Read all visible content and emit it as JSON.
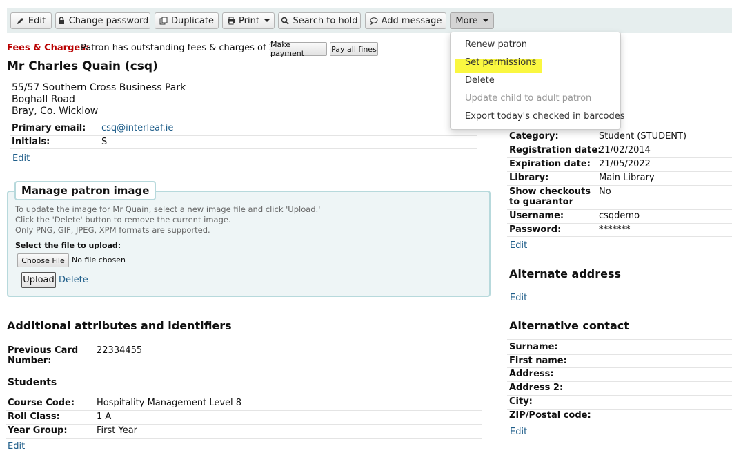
{
  "toolbar": {
    "edit": "Edit",
    "change_password": "Change password",
    "duplicate": "Duplicate",
    "print": "Print",
    "search_to_hold": "Search to hold",
    "add_message": "Add message",
    "more": "More"
  },
  "more_menu": {
    "renew": "Renew patron",
    "set_permissions": "Set permissions",
    "delete": "Delete",
    "update_child": "Update child to adult patron",
    "export_barcodes": "Export today's checked in barcodes"
  },
  "fees": {
    "label": "Fees & Charges:",
    "text": "Patron has outstanding fees & charges of 2.00.",
    "make_payment": "Make payment",
    "pay_all": "Pay all fines"
  },
  "patron": {
    "name": "Mr Charles Quain (csq)",
    "address1": "55/57 Southern Cross Business Park",
    "address2": "Boghall Road",
    "address3": "Bray, Co. Wicklow",
    "email_label": "Primary email:",
    "email": "csq@interleaf.ie",
    "initials_label": "Initials:",
    "initials": "S",
    "edit": "Edit"
  },
  "image_box": {
    "legend": "Manage patron image",
    "help1": "To update the image for Mr Quain, select a new image file and click 'Upload.'",
    "help2": "Click the 'Delete' button to remove the current image.",
    "help3": "Only PNG, GIF, JPEG, XPM formats are supported.",
    "select_label": "Select the file to upload:",
    "choose": "Choose File",
    "no_file": "No file chosen",
    "upload": "Upload",
    "delete": "Delete"
  },
  "attributes": {
    "heading": "Additional attributes and identifiers",
    "card_label_1": "Previous Card",
    "card_label_2": "Number:",
    "card_value": "22334455",
    "students_heading": "Students",
    "course_label": "Course Code:",
    "course_value": "Hospitality Management Level 8",
    "roll_label": "Roll Class:",
    "roll_value": "1 A",
    "year_label": "Year Group:",
    "year_value": "First Year",
    "edit": "Edit"
  },
  "library": {
    "category_label": "Category:",
    "category": "Student (STUDENT)",
    "reg_label": "Registration date:",
    "reg": "21/02/2014",
    "exp_label": "Expiration date:",
    "exp": "21/05/2022",
    "lib_label": "Library:",
    "lib": "Main Library",
    "show_label_1": "Show checkouts",
    "show_label_2": "to guarantor",
    "show": "No",
    "user_label": "Username:",
    "user": "csqdemo",
    "pass_label": "Password:",
    "pass": "*******",
    "edit": "Edit"
  },
  "alt_address": {
    "heading": "Alternate address",
    "edit": "Edit"
  },
  "alt_contact": {
    "heading": "Alternative contact",
    "surname": "Surname:",
    "first_name": "First name:",
    "address": "Address:",
    "address2": "Address 2:",
    "city": "City:",
    "zip": "ZIP/Postal code:",
    "edit": "Edit"
  },
  "colors": {
    "link": "#1f5e8a",
    "fees_red": "#b90000",
    "highlight": "#faf740",
    "fieldset_border": "#b7d9dc"
  }
}
